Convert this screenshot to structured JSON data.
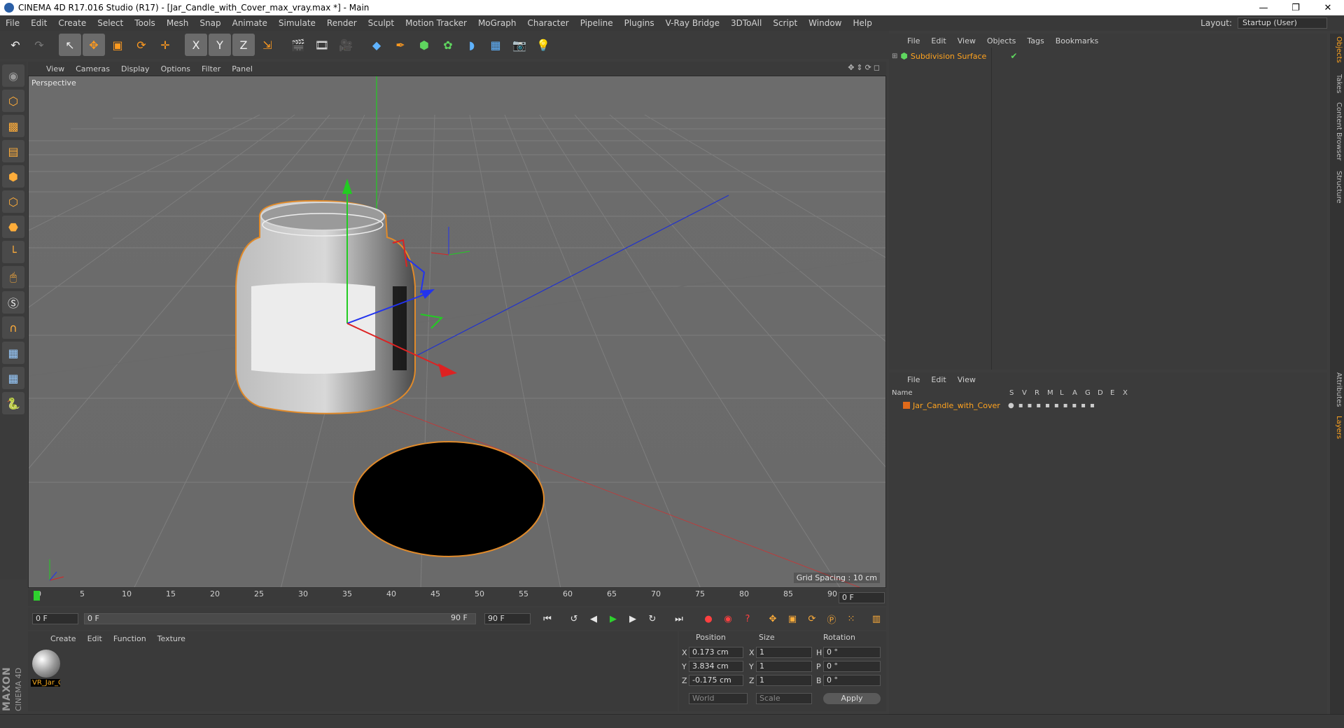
{
  "window": {
    "title": "CINEMA 4D R17.016 Studio (R17) - [Jar_Candle_with_Cover_max_vray.max *] - Main",
    "min": "—",
    "max": "❐",
    "close": "✕"
  },
  "menu": [
    "File",
    "Edit",
    "Create",
    "Select",
    "Tools",
    "Mesh",
    "Snap",
    "Animate",
    "Simulate",
    "Render",
    "Sculpt",
    "Motion Tracker",
    "MoGraph",
    "Character",
    "Pipeline",
    "Plugins",
    "V-Ray Bridge",
    "3DToAll",
    "Script",
    "Window",
    "Help"
  ],
  "layout": {
    "label": "Layout:",
    "value": "Startup (User)"
  },
  "toolbar": {
    "undo": "↶",
    "redo": "↷",
    "select": "↖",
    "move": "✥",
    "scale": "▣",
    "rotate": "⟳",
    "plus": "✛",
    "x": "X",
    "y": "Y",
    "z": "Z",
    "coord": "⇲"
  },
  "viewport": {
    "menu": [
      "View",
      "Cameras",
      "Display",
      "Options",
      "Filter",
      "Panel"
    ],
    "label": "Perspective",
    "grid_spacing": "Grid Spacing : 10 cm",
    "nav_icons": "✥⇕⟳◻"
  },
  "timeline": {
    "ticks": [
      "0",
      "5",
      "10",
      "15",
      "20",
      "25",
      "30",
      "35",
      "40",
      "45",
      "50",
      "55",
      "60",
      "65",
      "70",
      "75",
      "80",
      "85",
      "90"
    ],
    "current": "0 F"
  },
  "playback": {
    "start": "0 F",
    "range_start": "0 F",
    "range_end": "90 F",
    "end": "90 F"
  },
  "material": {
    "menu": [
      "Create",
      "Edit",
      "Function",
      "Texture"
    ],
    "name": "VR_Jar_C"
  },
  "coords": {
    "headers": {
      "position": "Position",
      "size": "Size",
      "rotation": "Rotation"
    },
    "rows": [
      {
        "axis": "X",
        "pos": "0.173 cm",
        "size_axis": "X",
        "size": "1",
        "rot_axis": "H",
        "rot": "0 °"
      },
      {
        "axis": "Y",
        "pos": "3.834 cm",
        "size_axis": "Y",
        "size": "1",
        "rot_axis": "P",
        "rot": "0 °"
      },
      {
        "axis": "Z",
        "pos": "-0.175 cm",
        "size_axis": "Z",
        "size": "1",
        "rot_axis": "B",
        "rot": "0 °"
      }
    ],
    "world": "World",
    "scale": "Scale",
    "apply": "Apply"
  },
  "brand": {
    "line1": "MAXON",
    "line2": "CINEMA 4D"
  },
  "objects": {
    "menu": [
      "File",
      "Edit",
      "View",
      "Objects",
      "Tags",
      "Bookmarks"
    ],
    "item": "Subdivision Surface"
  },
  "layers": {
    "menu": [
      "File",
      "Edit",
      "View"
    ],
    "columns": [
      "Name",
      "S",
      "V",
      "R",
      "M",
      "L",
      "A",
      "G",
      "D",
      "E",
      "X"
    ],
    "item": "Jar_Candle_with_Cover"
  },
  "side_tabs": [
    "Objects",
    "Takes",
    "Content Browser",
    "Structure",
    "Attributes",
    "Layers"
  ]
}
